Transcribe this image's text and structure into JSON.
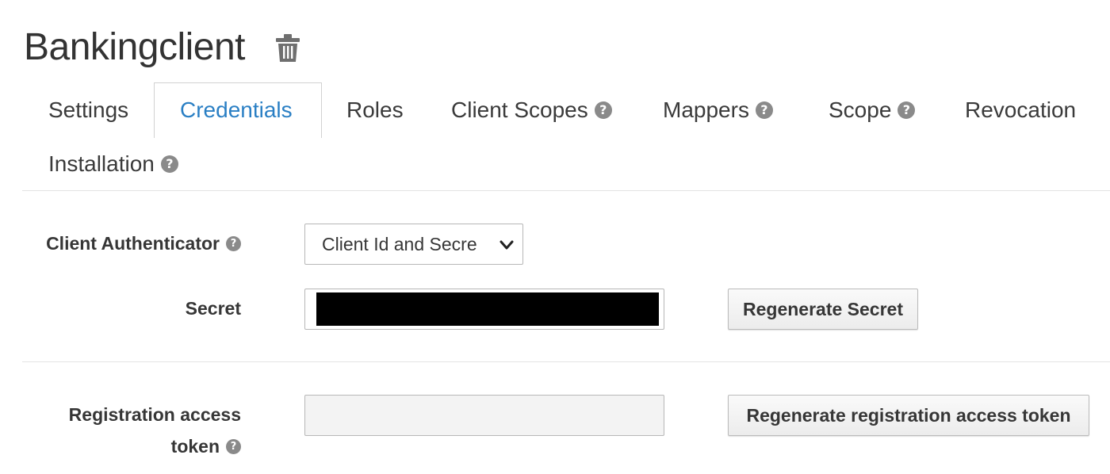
{
  "header": {
    "title": "Bankingclient"
  },
  "tabs": [
    {
      "label": "Settings",
      "active": false,
      "help": false
    },
    {
      "label": "Credentials",
      "active": true,
      "help": false
    },
    {
      "label": "Roles",
      "active": false,
      "help": false
    },
    {
      "label": "Client Scopes",
      "active": false,
      "help": true
    },
    {
      "label": "Mappers",
      "active": false,
      "help": true
    },
    {
      "label": "Scope",
      "active": false,
      "help": true
    },
    {
      "label": "Revocation",
      "active": false,
      "help": false
    },
    {
      "label": "Installation",
      "active": false,
      "help": true
    }
  ],
  "form": {
    "client_authenticator": {
      "label": "Client Authenticator",
      "selected": "Client Id and Secre"
    },
    "secret": {
      "label": "Secret",
      "button": "Regenerate Secret"
    },
    "registration": {
      "label_line1": "Registration access",
      "label_line2": "token",
      "button": "Regenerate registration access token"
    }
  },
  "icons": {
    "help": "?",
    "delete": "trash-icon",
    "dropdown": "chevron-down-icon"
  },
  "colors": {
    "active_tab": "#2a7fc4",
    "text": "#363636",
    "help_icon": "#8a8a8a"
  }
}
